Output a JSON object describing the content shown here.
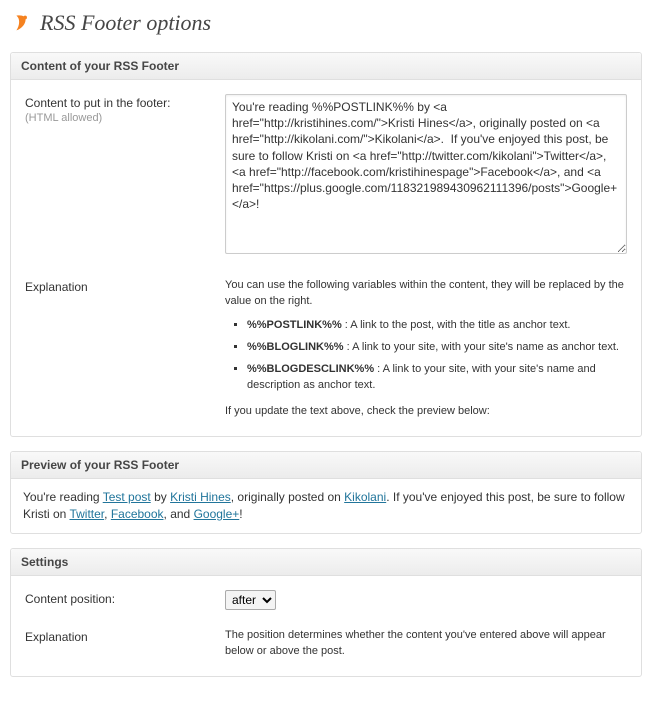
{
  "page": {
    "title": "RSS Footer options",
    "icon": "rss-footer-logo"
  },
  "panel_content": {
    "heading": "Content of your RSS Footer",
    "content_label": "Content to put in the footer:",
    "content_sublabel": "(HTML allowed)",
    "textarea_value": "You're reading %%POSTLINK%% by <a href=\"http://kristihines.com/\">Kristi Hines</a>, originally posted on <a href=\"http://kikolani.com/\">Kikolani</a>.  If you've enjoyed this post, be sure to follow Kristi on <a href=\"http://twitter.com/kikolani\">Twitter</a>, <a href=\"http://facebook.com/kristihinespage\">Facebook</a>, and <a href=\"https://plus.google.com/118321989430962111396/posts\">Google+</a>!",
    "explanation_label": "Explanation",
    "explanation_intro": "You can use the following variables within the content, they will be replaced by the value on the right.",
    "vars": [
      {
        "name": "%%POSTLINK%%",
        "desc": " : A link to the post, with the title as anchor text."
      },
      {
        "name": "%%BLOGLINK%%",
        "desc": " : A link to your site, with your site's name as anchor text."
      },
      {
        "name": "%%BLOGDESCLINK%%",
        "desc": " : A link to your site, with your site's name and description as anchor text."
      }
    ],
    "explanation_outro": "If you update the text above, check the preview below:"
  },
  "panel_preview": {
    "heading": "Preview of your RSS Footer",
    "preview_parts": {
      "p1": "You're reading ",
      "link_post": "Test post",
      "p2": " by ",
      "link_author": "Kristi Hines",
      "p3": ", originally posted on ",
      "link_site": "Kikolani",
      "p4": ". If you've enjoyed this post, be sure to follow Kristi on ",
      "link_tw": "Twitter",
      "p5": ", ",
      "link_fb": "Facebook",
      "p6": ", and ",
      "link_gp": "Google+",
      "p7": "!"
    }
  },
  "panel_settings": {
    "heading": "Settings",
    "position_label": "Content position:",
    "position_value": "after",
    "explanation_label": "Explanation",
    "explanation_text": "The position determines whether the content you've entered above will appear below or above the post."
  }
}
